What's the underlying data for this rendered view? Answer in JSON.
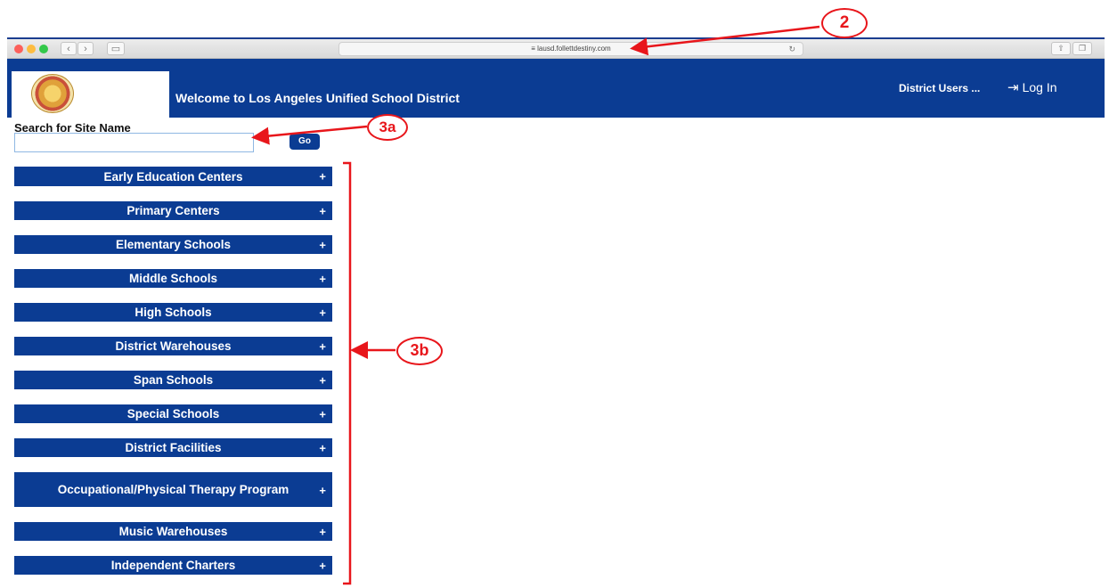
{
  "browser": {
    "url": "lausd.follettdestiny.com",
    "back_icon": "chevron-left",
    "forward_icon": "chevron-right",
    "reload_icon": "reload",
    "share_icon": "share",
    "tabs_icon": "tabs"
  },
  "header": {
    "welcome": "Welcome to Los Angeles Unified School District",
    "district_users": "District Users ...",
    "login": "Log In",
    "login_icon": "login-arrow"
  },
  "search": {
    "label": "Search for Site Name",
    "value": "",
    "go_label": "Go"
  },
  "categories": [
    {
      "label": "Early Education Centers",
      "toggle": "+"
    },
    {
      "label": "Primary Centers",
      "toggle": "+"
    },
    {
      "label": "Elementary Schools",
      "toggle": "+"
    },
    {
      "label": "Middle Schools",
      "toggle": "+"
    },
    {
      "label": "High Schools",
      "toggle": "+"
    },
    {
      "label": "District Warehouses",
      "toggle": "+"
    },
    {
      "label": "Span Schools",
      "toggle": "+"
    },
    {
      "label": "Special Schools",
      "toggle": "+"
    },
    {
      "label": "District Facilities",
      "toggle": "+"
    },
    {
      "label": "Occupational/Physical Therapy Program",
      "toggle": "+"
    },
    {
      "label": "Music Warehouses",
      "toggle": "+"
    },
    {
      "label": "Independent Charters",
      "toggle": "+"
    }
  ],
  "annotations": {
    "url_marker": "2",
    "search_marker": "3a",
    "list_marker": "3b"
  },
  "colors": {
    "brand_blue": "#0b3c93",
    "annotation_red": "#e8161b"
  }
}
